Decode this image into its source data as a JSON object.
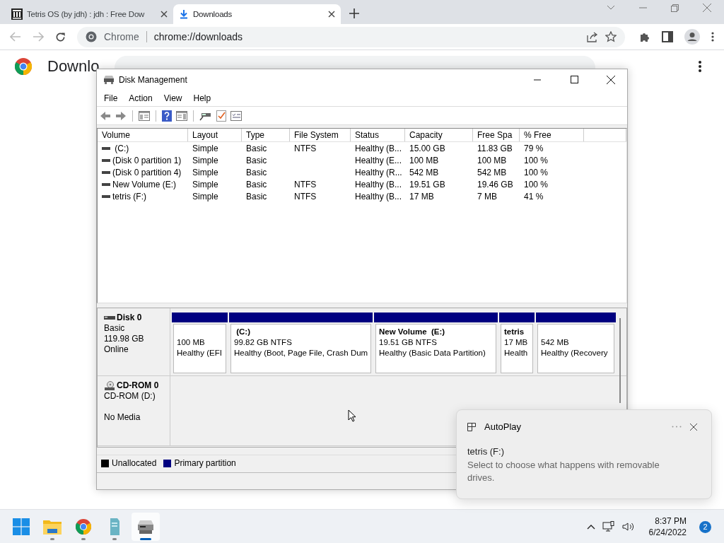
{
  "browser": {
    "tabs": [
      {
        "title": "Tetris OS (by jdh) : jdh : Free Dow",
        "selected": false
      },
      {
        "title": "Downloads",
        "selected": true
      }
    ],
    "address": {
      "site": "Chrome",
      "url": "chrome://downloads"
    },
    "page": {
      "heading": "Downlo"
    }
  },
  "disk_management": {
    "title": "Disk Management",
    "menu": [
      "File",
      "Action",
      "View",
      "Help"
    ],
    "columns": [
      "Volume",
      "Layout",
      "Type",
      "File System",
      "Status",
      "Capacity",
      "Free Spa",
      "% Free"
    ],
    "rows": [
      [
        " (C:)",
        "Simple",
        "Basic",
        "NTFS",
        "Healthy (B...",
        "15.00 GB",
        "11.83 GB",
        "79 %"
      ],
      [
        "(Disk 0 partition 1)",
        "Simple",
        "Basic",
        "",
        "Healthy (E...",
        "100 MB",
        "100 MB",
        "100 %"
      ],
      [
        "(Disk 0 partition 4)",
        "Simple",
        "Basic",
        "",
        "Healthy (R...",
        "542 MB",
        "542 MB",
        "100 %"
      ],
      [
        "New Volume (E:)",
        "Simple",
        "Basic",
        "NTFS",
        "Healthy (B...",
        "19.51 GB",
        "19.46 GB",
        "100 %"
      ],
      [
        "tetris (F:)",
        "Simple",
        "Basic",
        "NTFS",
        "Healthy (B...",
        "17 MB",
        "7 MB",
        "41 %"
      ]
    ],
    "disks": [
      {
        "kind": "disk",
        "name": "Disk 0",
        "lines": [
          "Basic",
          "119.98 GB",
          "Online"
        ],
        "partitions": [
          {
            "size": "100 MB",
            "status": "Healthy (EFI"
          },
          {
            "title": " (C:)",
            "size": "99.82 GB NTFS",
            "status": "Healthy (Boot, Page File, Crash Dum"
          },
          {
            "title": "New Volume  (E:)",
            "size": "19.51 GB NTFS",
            "status": "Healthy (Basic Data Partition)"
          },
          {
            "title": "tetris",
            "size": "17 MB",
            "status": "Health"
          },
          {
            "size": "542 MB",
            "status": "Healthy (Recovery"
          }
        ]
      },
      {
        "kind": "cdrom",
        "name": "CD-ROM 0",
        "lines": [
          "CD-ROM (D:)"
        ],
        "media": "No Media"
      }
    ],
    "legend": [
      {
        "label": "Unallocated",
        "color": "#000000"
      },
      {
        "label": "Primary partition",
        "color": "#000080"
      }
    ]
  },
  "autoplay": {
    "title": "AutoPlay",
    "drive": "tetris (F:)",
    "message": "Select to choose what happens with removable drives."
  },
  "taskbar": {
    "apps": [
      {
        "kind": "start",
        "running": false,
        "selected": false
      },
      {
        "kind": "explorer",
        "running": true,
        "selected": false
      },
      {
        "kind": "chrome",
        "running": true,
        "selected": false
      },
      {
        "kind": "notes",
        "running": true,
        "selected": false
      },
      {
        "kind": "diskmgmt",
        "running": true,
        "selected": true
      }
    ],
    "time": "8:37 PM",
    "date": "6/24/2022",
    "notifications": "2"
  }
}
